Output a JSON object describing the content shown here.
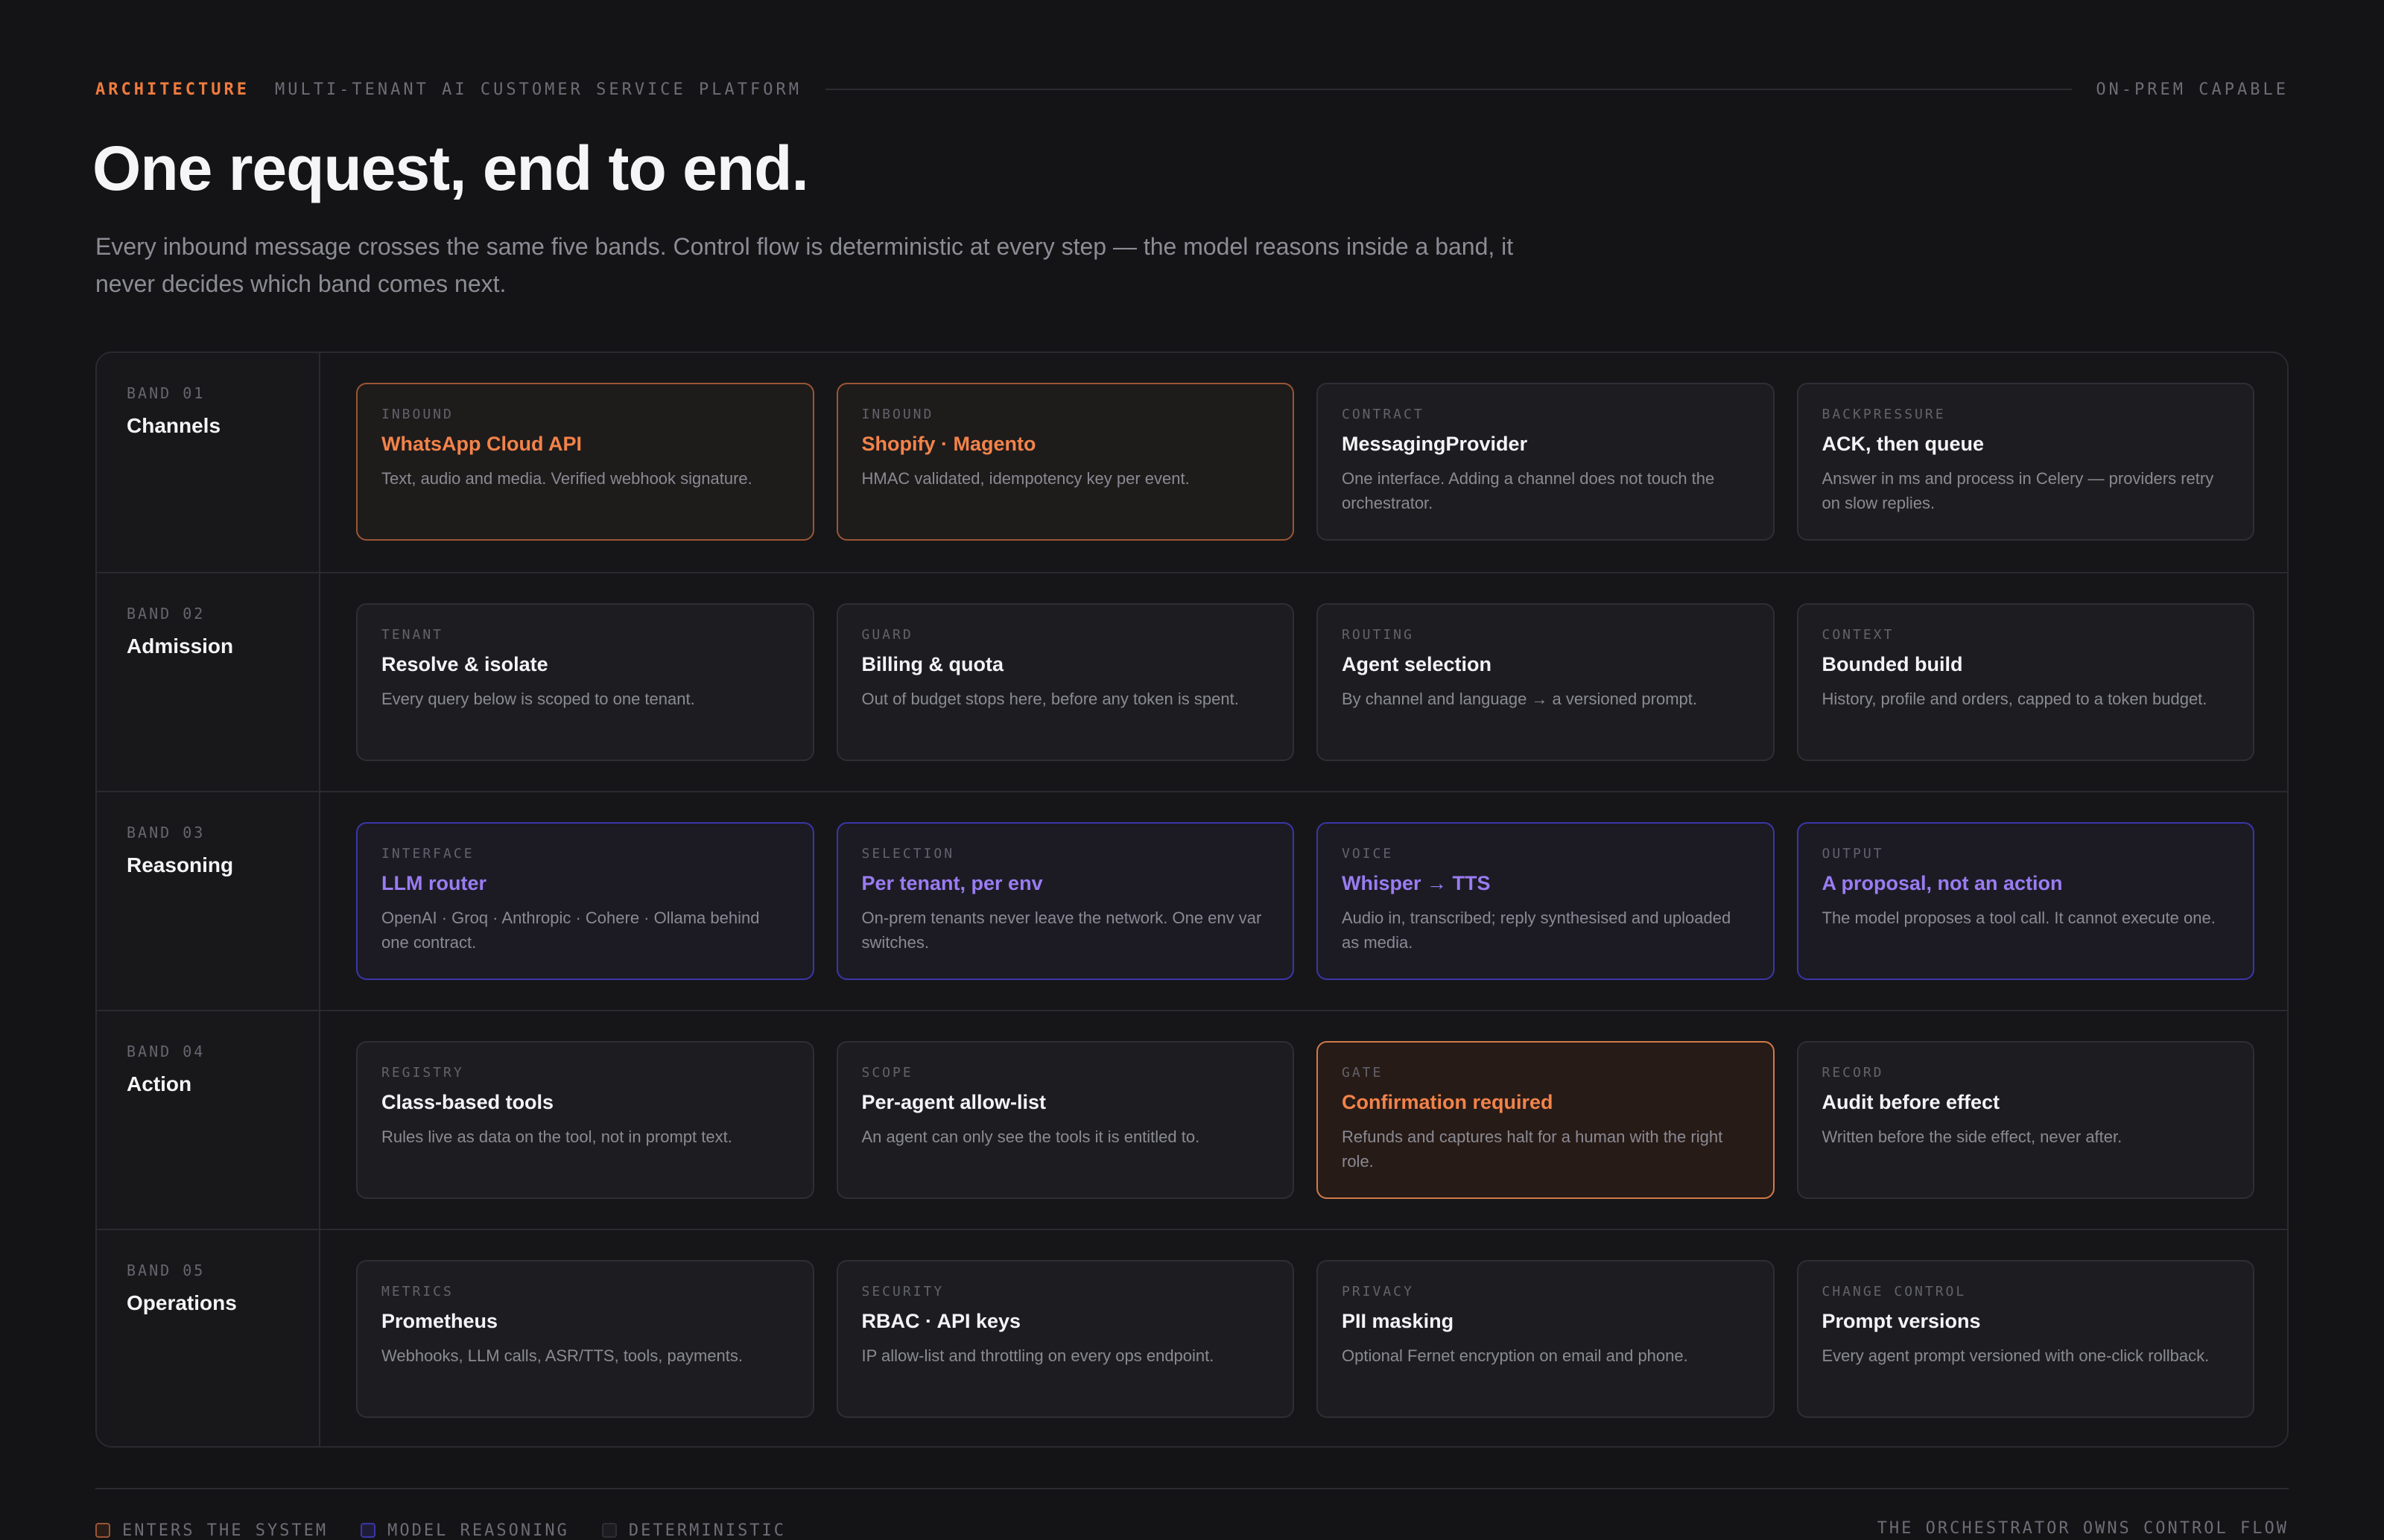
{
  "header": {
    "eyebrow": "ARCHITECTURE",
    "subtitle": "MULTI-TENANT AI CUSTOMER SERVICE PLATFORM",
    "right_tag": "ON-PREM CAPABLE",
    "headline": "One request, end to end.",
    "lede": "Every inbound message crosses the same five bands. Control flow is deterministic at every step — the model reasons inside a band, it never decides which band comes next."
  },
  "bands": [
    {
      "number": "BAND 01",
      "name": "Channels",
      "cards": [
        {
          "tag": "INBOUND",
          "title": "WhatsApp Cloud API",
          "desc": "Text, audio and media. Verified webhook signature.",
          "style": "accent"
        },
        {
          "tag": "INBOUND",
          "title": "Shopify · Magento",
          "desc": "HMAC validated, idempotency key per event.",
          "style": "accent"
        },
        {
          "tag": "CONTRACT",
          "title": "MessagingProvider",
          "desc": "One interface. Adding a channel does not touch the orchestrator.",
          "style": "plain"
        },
        {
          "tag": "BACKPRESSURE",
          "title": "ACK, then queue",
          "desc": "Answer in ms and process in Celery — providers retry on slow replies.",
          "style": "plain"
        }
      ]
    },
    {
      "number": "BAND 02",
      "name": "Admission",
      "cards": [
        {
          "tag": "TENANT",
          "title": "Resolve & isolate",
          "desc": "Every query below is scoped to one tenant.",
          "style": "plain"
        },
        {
          "tag": "GUARD",
          "title": "Billing & quota",
          "desc": "Out of budget stops here, before any token is spent.",
          "style": "plain"
        },
        {
          "tag": "ROUTING",
          "title": "Agent selection",
          "desc": "By channel and language → a versioned prompt.",
          "style": "plain"
        },
        {
          "tag": "CONTEXT",
          "title": "Bounded build",
          "desc": "History, profile and orders, capped to a token budget.",
          "style": "plain"
        }
      ]
    },
    {
      "number": "BAND 03",
      "name": "Reasoning",
      "cards": [
        {
          "tag": "INTERFACE",
          "title": "LLM router",
          "desc": "OpenAI · Groq · Anthropic · Cohere · Ollama behind one contract.",
          "style": "purple"
        },
        {
          "tag": "SELECTION",
          "title": "Per tenant, per env",
          "desc": "On-prem tenants never leave the network. One env var switches.",
          "style": "purple"
        },
        {
          "tag": "VOICE",
          "title": "Whisper → TTS",
          "desc": "Audio in, transcribed; reply synthesised and uploaded as media.",
          "style": "purple"
        },
        {
          "tag": "OUTPUT",
          "title": "A proposal, not an action",
          "desc": "The model proposes a tool call. It cannot execute one.",
          "style": "purple"
        }
      ]
    },
    {
      "number": "BAND 04",
      "name": "Action",
      "cards": [
        {
          "tag": "REGISTRY",
          "title": "Class-based tools",
          "desc": "Rules live as data on the tool, not in prompt text.",
          "style": "plain"
        },
        {
          "tag": "SCOPE",
          "title": "Per-agent allow-list",
          "desc": "An agent can only see the tools it is entitled to.",
          "style": "plain"
        },
        {
          "tag": "GATE",
          "title": "Confirmation required",
          "desc": "Refunds and captures halt for a human with the right role.",
          "style": "gate"
        },
        {
          "tag": "RECORD",
          "title": "Audit before effect",
          "desc": "Written before the side effect, never after.",
          "style": "plain"
        }
      ]
    },
    {
      "number": "BAND 05",
      "name": "Operations",
      "cards": [
        {
          "tag": "METRICS",
          "title": "Prometheus",
          "desc": "Webhooks, LLM calls, ASR/TTS, tools, payments.",
          "style": "plain"
        },
        {
          "tag": "SECURITY",
          "title": "RBAC · API keys",
          "desc": "IP allow-list and throttling on every ops endpoint.",
          "style": "plain"
        },
        {
          "tag": "PRIVACY",
          "title": "PII masking",
          "desc": "Optional Fernet encryption on email and phone.",
          "style": "plain"
        },
        {
          "tag": "CHANGE CONTROL",
          "title": "Prompt versions",
          "desc": "Every agent prompt versioned with one-click rollback.",
          "style": "plain"
        }
      ]
    }
  ],
  "legend": {
    "items": [
      {
        "label": "ENTERS THE SYSTEM",
        "border": "#9a5634",
        "fill": "#2a1d18"
      },
      {
        "label": "MODEL REASONING",
        "border": "#3b36a8",
        "fill": "#1f1c3a"
      },
      {
        "label": "DETERMINISTIC",
        "border": "#2e2e34",
        "fill": "#1d1d21"
      }
    ],
    "right": "THE ORCHESTRATOR OWNS CONTROL FLOW"
  }
}
